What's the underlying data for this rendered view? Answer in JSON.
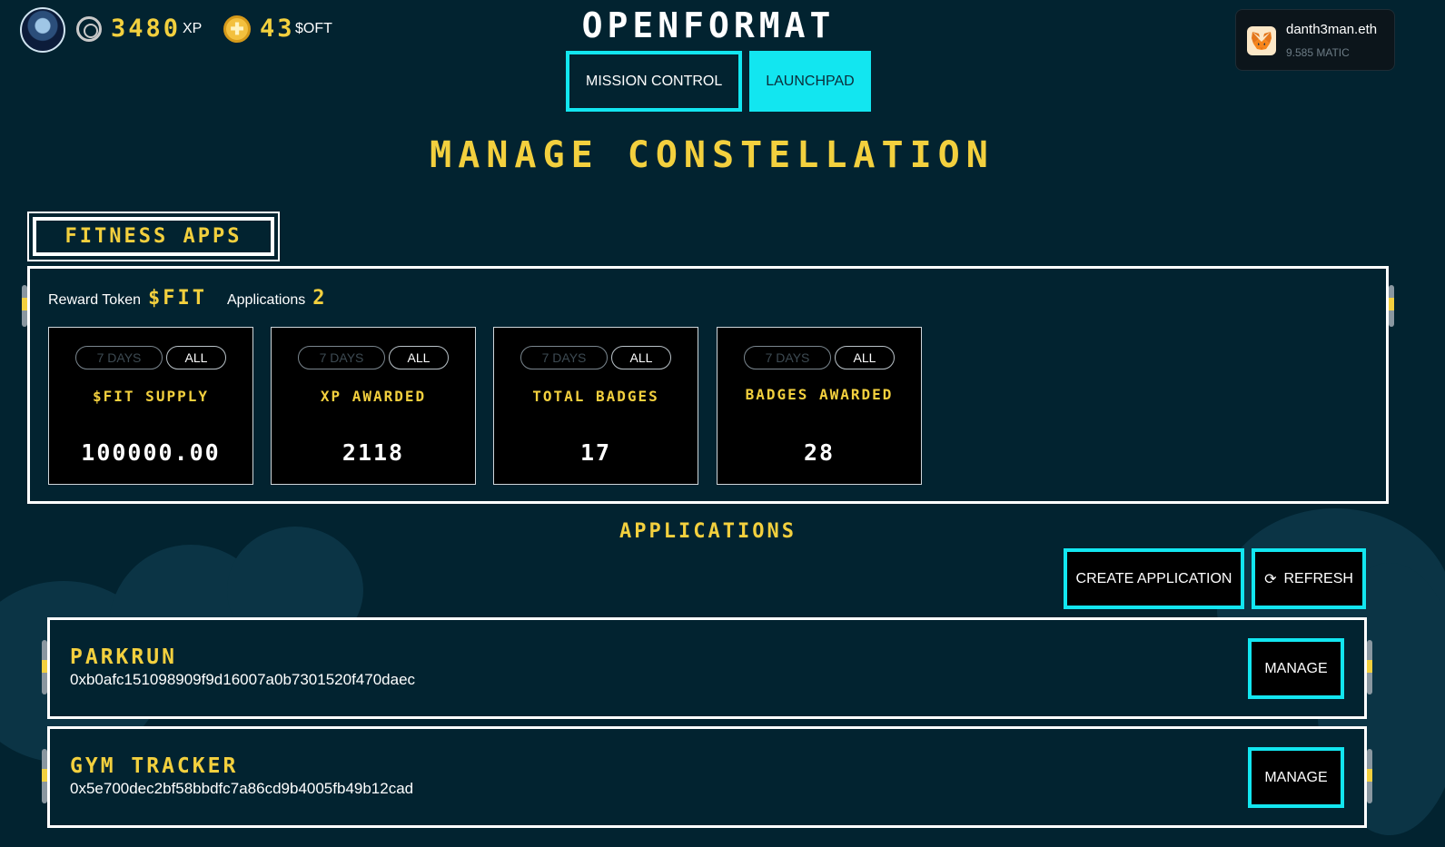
{
  "header": {
    "xp_value": "3480",
    "xp_unit": "XP",
    "token_value": "43",
    "token_unit": "$OFT",
    "brand": "OPENFORMAT",
    "nav": {
      "mission_control": "MISSION CONTROL",
      "launchpad": "LAUNCHPAD"
    },
    "wallet": {
      "name": "danth3man.eth",
      "balance": "9.585 MATIC"
    }
  },
  "page_title": "MANAGE CONSTELLATION",
  "constellation": {
    "name": "FITNESS APPS",
    "reward_token_label": "Reward Token",
    "reward_token_value": "$FIT",
    "applications_label": "Applications",
    "applications_value": "2"
  },
  "stats": [
    {
      "label": "$FIT SUPPLY",
      "value": "100000.00",
      "days_label": "7 DAYS",
      "all_label": "ALL"
    },
    {
      "label": "XP AWARDED",
      "value": "2118",
      "days_label": "7 DAYS",
      "all_label": "ALL"
    },
    {
      "label": "TOTAL BADGES",
      "value": "17",
      "days_label": "7 DAYS",
      "all_label": "ALL"
    },
    {
      "label": "BADGES AWARDED",
      "value": "28",
      "days_label": "7 DAYS",
      "all_label": "ALL"
    }
  ],
  "applications": {
    "heading": "APPLICATIONS",
    "create_label": "CREATE APPLICATION",
    "refresh_label": "REFRESH",
    "items": [
      {
        "name": "PARKRUN",
        "address": "0xb0afc151098909f9d16007a0b7301520f470daec",
        "manage_label": "MANAGE"
      },
      {
        "name": "GYM TRACKER",
        "address": "0x5e700dec2bf58bbdfc7a86cd9b4005fb49b12cad",
        "manage_label": "MANAGE"
      }
    ]
  },
  "colors": {
    "background": "#022330",
    "accent_cyan": "#12e6f0",
    "accent_yellow": "#f3d03e"
  },
  "icons": [
    "avatar",
    "xp-badge-icon",
    "coin-icon",
    "metamask-fox-icon",
    "refresh-icon"
  ]
}
